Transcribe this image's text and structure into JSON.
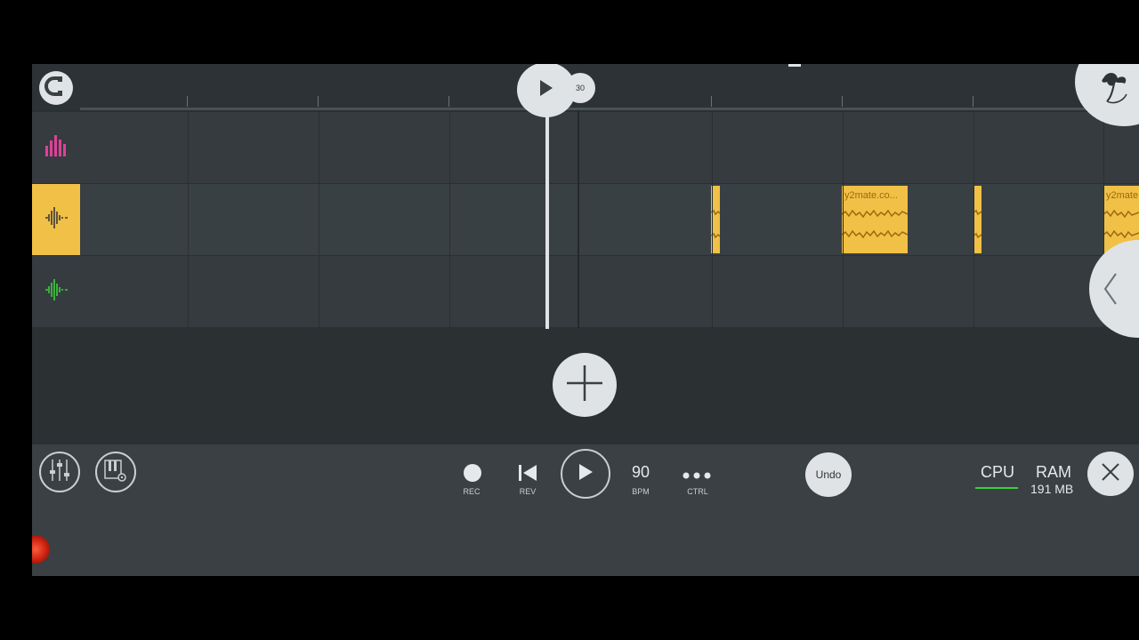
{
  "timeline": {
    "bar_number": "30"
  },
  "tracks": [
    {
      "icon": "bar-graph-icon",
      "color": "#e0409a"
    },
    {
      "icon": "waveform-icon",
      "color": "#3a3a3a",
      "selected": true
    },
    {
      "icon": "waveform-icon",
      "color": "#3ccf3c"
    }
  ],
  "clips": [
    {
      "label": "y2mate.co..."
    },
    {
      "label": "y2mate"
    }
  ],
  "transport": {
    "rec_label": "REC",
    "rev_label": "REV",
    "bpm_value": "90",
    "bpm_label": "BPM",
    "ctrl_label": "CTRL",
    "undo_label": "Undo"
  },
  "status": {
    "cpu_label": "CPU",
    "ram_label": "RAM",
    "ram_value": "191 MB"
  },
  "colors": {
    "clip": "#f1c046",
    "cpu_bar": "#3ccf3c"
  }
}
